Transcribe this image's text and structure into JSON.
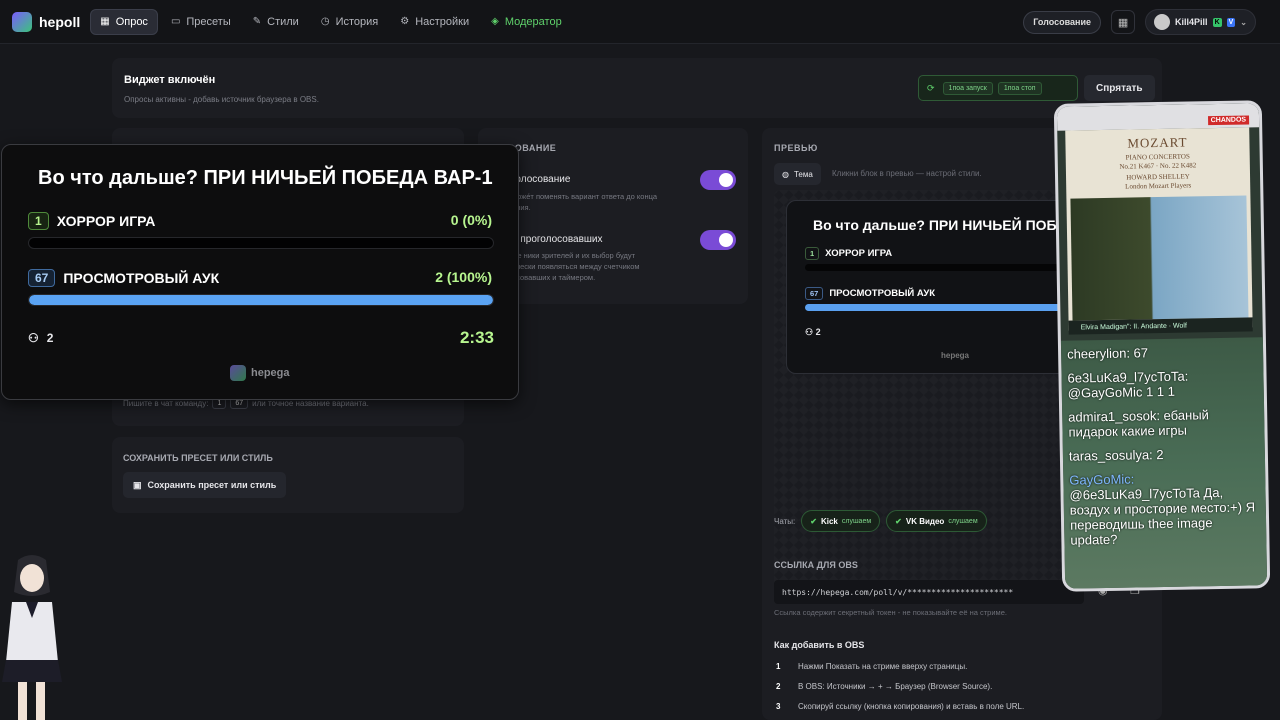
{
  "nav": {
    "logo": "hepoll",
    "items": [
      {
        "label": "Опрос",
        "icon": "▦",
        "active": true
      },
      {
        "label": "Пресеты",
        "icon": "▭"
      },
      {
        "label": "Стили",
        "icon": "✎"
      },
      {
        "label": "История",
        "icon": "◷"
      },
      {
        "label": "Настройки",
        "icon": "⚙"
      },
      {
        "label": "Модератор",
        "icon": "◈"
      }
    ],
    "vote_button": "Голосование",
    "username": "Kill4Pill",
    "badge_k": "K",
    "badge_v": "V"
  },
  "status": {
    "title": "Виджет включён",
    "subtitle": "Опросы активны - добавь источник браузера в OBS.",
    "chip1": "1поа запуск",
    "chip2": "1поа стоп",
    "hide_button": "Спрятать"
  },
  "voting": {
    "header": "СОВАНИЕ",
    "opt1_title": "голосование",
    "opt1_desc_1": "може́т поменять вариант ответа до конца",
    "opt1_desc_2": "ания.",
    "opt2_title": "а проголосовавших",
    "opt2_desc_1": "ые ники зрителей и их выбор будут",
    "opt2_desc_2": "ически появляться между счетчиком",
    "opt2_desc_3": "осовавших и таймером."
  },
  "left": {
    "hint": "Пишите в чат команду:",
    "hint_cmd1": "1",
    "hint_cmd2": "67",
    "hint_tail": "или точное название варианта.",
    "save_header": "СОХРАНИТЬ ПРЕСЕТ ИЛИ СТИЛЬ",
    "save_button": "Сохранить пресет или стиль"
  },
  "preview": {
    "header": "ПРЕВЬЮ",
    "theme_button": "Тема",
    "hint": "Кликни блок в превью — настрой стили.",
    "chats_label": "Чаты:",
    "chat1": "Kick",
    "chat1_status": "слушаем",
    "chat2": "VK Видео",
    "chat2_status": "слушаем",
    "obs_header": "ССЫЛКА ДЛЯ OBS",
    "obs_url": "https://hepega.com/poll/v/**********************",
    "obs_note": "Ссылка содержит секретный токен - не показывайте её на стриме.",
    "how_header": "Как добавить в OBS",
    "steps": [
      {
        "n": "1",
        "text": "Нажми Показать на стриме вверху страницы."
      },
      {
        "n": "2",
        "text": "В OBS: Источники → + → Браузер (Browser Source)."
      },
      {
        "n": "3",
        "text": "Скопируй ссылку (кнопка копирования) и вставь в поле URL."
      }
    ]
  },
  "poll": {
    "question": "Во что дальше? ПРИ НИЧЬЕЙ ПОБЕДА ВАР-1",
    "options": [
      {
        "num": "1",
        "label": "ХОРРОР ИГРА",
        "result": "0 (0%)",
        "share": 0
      },
      {
        "num": "67",
        "label": "ПРОСМОТРОВЫЙ АУК",
        "result": "2 (100%)",
        "share": 1
      }
    ],
    "voters": "2",
    "timer": "2:33",
    "brand": "hepega"
  },
  "stream_overlay": {
    "album_title": "MOZART",
    "album_sub1": "PIANO CONCERTOS",
    "album_sub2": "No.21 K467 · No. 22 K482",
    "album_sub3": "HOWARD SHELLEY",
    "album_sub4": "London Mozart Players",
    "channel_badge": "CHANDOS",
    "now_playing": "Elvira Madigan\": II. Andante · Wolf",
    "chat": [
      {
        "user": "cheerylion:",
        "msg": " 67"
      },
      {
        "user": "6e3LuKa9_l7ycToTa:",
        "msg": " @GayGoMic 1 1 1"
      },
      {
        "user": "admira1_sosok:",
        "msg": " ебаный пидарок какие игры"
      },
      {
        "user": "taras_sosulya:",
        "msg": " 2"
      },
      {
        "user": "GayGoMic:",
        "msg": " @6e3LuKa9_l7ycToTa Да, воздух и простоpие место:+) Я переводишь thee image update?"
      }
    ]
  }
}
